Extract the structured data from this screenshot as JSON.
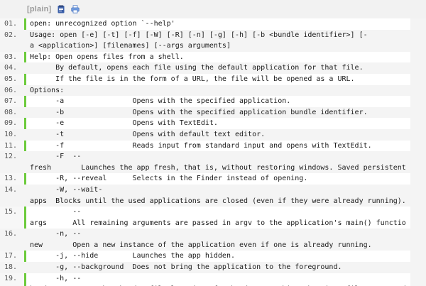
{
  "toolbar": {
    "plain_label": "[plain]",
    "copy_icon": "clipboard-icon",
    "print_icon": "printer-icon"
  },
  "colors": {
    "accent": "#6ccb3c",
    "gutter": "#f7f7f7",
    "stripe": "#f4f4f4",
    "toolbar_text": "#9a9a9a"
  },
  "code": {
    "lines": [
      {
        "num": "01.",
        "rows": [
          "open: unrecognized option `--help'"
        ]
      },
      {
        "num": "02.",
        "rows": [
          "Usage: open [-e] [-t] [-f] [-W] [-R] [-n] [-g] [-h] [-b <bundle identifier>] [-",
          "a <application>] [filenames] [--args arguments]"
        ]
      },
      {
        "num": "03.",
        "rows": [
          "Help: Open opens files from a shell."
        ]
      },
      {
        "num": "04.",
        "rows": [
          "      By default, opens each file using the default application for that file."
        ]
      },
      {
        "num": "05.",
        "rows": [
          "      If the file is in the form of a URL, the file will be opened as a URL."
        ]
      },
      {
        "num": "06.",
        "rows": [
          "Options:"
        ]
      },
      {
        "num": "07.",
        "rows": [
          "      -a                Opens with the specified application."
        ]
      },
      {
        "num": "08.",
        "rows": [
          "      -b                Opens with the specified application bundle identifier."
        ]
      },
      {
        "num": "09.",
        "rows": [
          "      -e                Opens with TextEdit."
        ]
      },
      {
        "num": "10.",
        "rows": [
          "      -t                Opens with default text editor."
        ]
      },
      {
        "num": "11.",
        "rows": [
          "      -f                Reads input from standard input and opens with TextEdit."
        ]
      },
      {
        "num": "12.",
        "rows": [
          "      -F  --",
          "fresh       Launches the app fresh, that is, without restoring windows. Saved persistent s"
        ]
      },
      {
        "num": "13.",
        "rows": [
          "      -R, --reveal      Selects in the Finder instead of opening."
        ]
      },
      {
        "num": "14.",
        "rows": [
          "      -W, --wait-",
          "apps  Blocks until the used applications are closed (even if they were already running)."
        ]
      },
      {
        "num": "15.",
        "rows": [
          "          --",
          "args      All remaining arguments are passed in argv to the application's main() functio"
        ]
      },
      {
        "num": "16.",
        "rows": [
          "      -n, --",
          "new       Open a new instance of the application even if one is already running."
        ]
      },
      {
        "num": "17.",
        "rows": [
          "      -j, --hide        Launches the app hidden."
        ]
      },
      {
        "num": "18.",
        "rows": [
          "      -g, --background  Does not bring the application to the foreground."
        ]
      },
      {
        "num": "19.",
        "rows": [
          "      -h, --",
          "header      Searches header file locations for headers matching the given filenames, and o"
        ]
      }
    ]
  }
}
